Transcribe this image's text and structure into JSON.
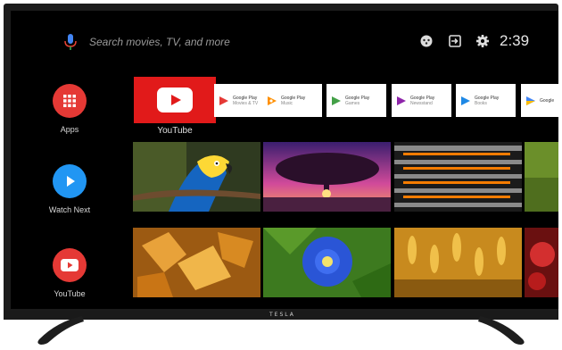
{
  "search": {
    "placeholder": "Search movies, TV, and more"
  },
  "status": {
    "time": "2:39"
  },
  "rail": [
    {
      "label": "Apps"
    },
    {
      "label": "Watch Next"
    },
    {
      "label": "YouTube"
    }
  ],
  "apps": {
    "youtube_label": "YouTube",
    "tiles": [
      {
        "line1": "Google Play",
        "line2": "Movies & TV"
      },
      {
        "line1": "Google Play",
        "line2": "Music"
      },
      {
        "line1": "Google Play",
        "line2": "Games"
      },
      {
        "line1": "Google Play",
        "line2": "Newsstand"
      },
      {
        "line1": "Google Play",
        "line2": "Books"
      },
      {
        "line1": "Google",
        "line2": ""
      }
    ]
  },
  "brand": {
    "logo_text": "TESLA"
  },
  "colors": {
    "accent_red": "#e11a1a",
    "watch_next_blue": "#2196f3",
    "screen_bg": "#000000"
  }
}
